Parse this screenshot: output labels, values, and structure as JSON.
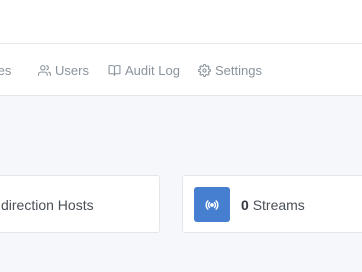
{
  "nav": {
    "hosts_label": "tes",
    "users_label": "Users",
    "audit_label": "Audit Log",
    "settings_label": "Settings"
  },
  "cards": {
    "redirection_label": "direction Hosts",
    "streams_count": "0",
    "streams_label": "Streams"
  },
  "colors": {
    "accent": "#467fcf",
    "nav_text": "#8a939c",
    "page_bg": "#f5f7fb"
  },
  "icons": {
    "users": "users-icon",
    "audit": "book-icon",
    "settings": "gear-icon",
    "streams": "radio-signal-icon"
  }
}
